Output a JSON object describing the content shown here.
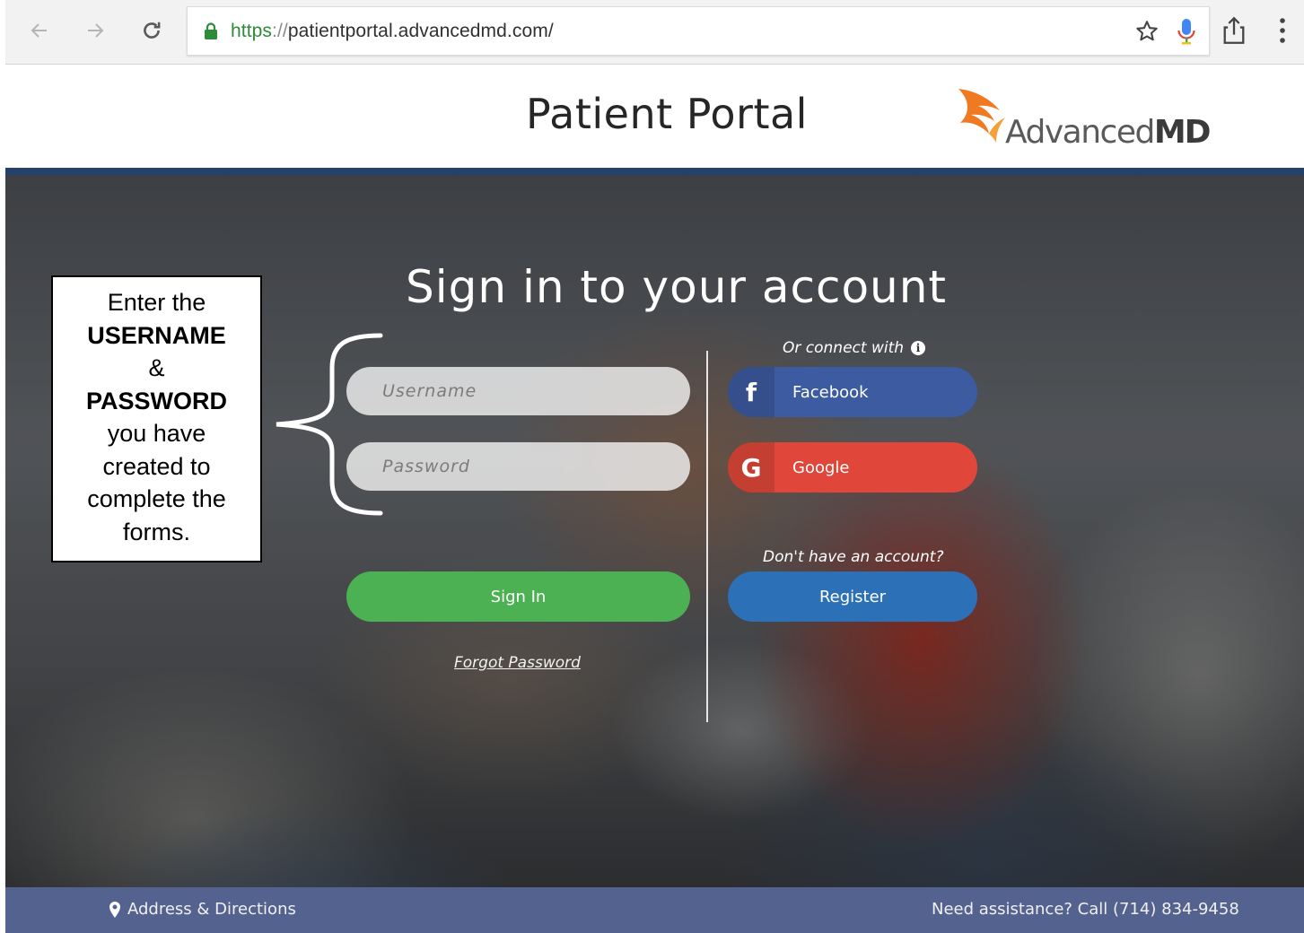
{
  "browser": {
    "url_scheme": "https",
    "url_sep": "://",
    "url_host": "patientportal.advancedmd.com/"
  },
  "header": {
    "title": "Patient Portal",
    "logo_text_light": "Advanced",
    "logo_text_bold": "MD"
  },
  "login": {
    "heading": "Sign in to your account",
    "username_placeholder": "Username",
    "password_placeholder": "Password",
    "sign_in_label": "Sign In",
    "forgot_password_label": "Forgot Password"
  },
  "social": {
    "connect_label": "Or connect with",
    "facebook_label": "Facebook",
    "google_label": "Google"
  },
  "register": {
    "prompt": "Don't have an account?",
    "button_label": "Register"
  },
  "callout": {
    "line1": "Enter the",
    "line2": "USERNAME",
    "line3": "&",
    "line4": "PASSWORD",
    "line5": "you have",
    "line6": "created to",
    "line7": "complete the",
    "line8": "forms."
  },
  "footer": {
    "address_label": "Address & Directions",
    "assistance_label": "Need assistance? Call (714) 834-9458"
  },
  "colors": {
    "header_rule": "#23416b",
    "sign_in": "#4cb152",
    "register": "#2c71b8",
    "facebook": "#3c5ba0",
    "google": "#e0473a",
    "footer": "#54628f",
    "logo_orange": "#f07a22"
  }
}
